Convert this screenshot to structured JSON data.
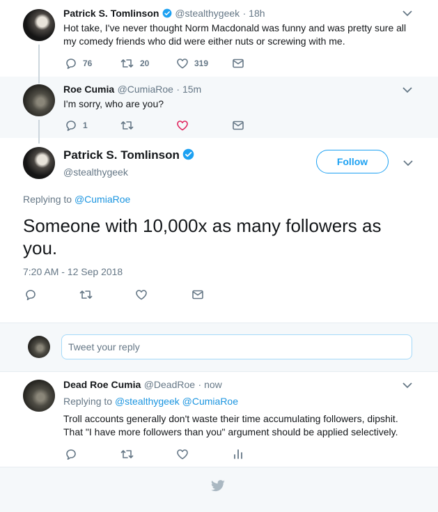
{
  "tweet1": {
    "author": "Patrick S. Tomlinson",
    "handle": "@stealthygeek",
    "time": "· 18h",
    "text": "Hot take, I've never thought Norm Macdonald was funny and was pretty sure all my comedy friends who did were either nuts or screwing with me.",
    "replies": "76",
    "retweets": "20",
    "likes": "319"
  },
  "tweet2": {
    "author": "Roe Cumia",
    "handle": "@CumiaRoe",
    "time": "· 15m",
    "text": "I'm sorry, who are you?",
    "replies": "1"
  },
  "main": {
    "author": "Patrick S. Tomlinson",
    "handle": "@stealthygeek",
    "follow_label": "Follow",
    "replying_prefix": "Replying to ",
    "replying_to": "@CumiaRoe",
    "text": "Someone with 10,000x as many followers as you.",
    "timestamp": "7:20 AM - 12 Sep 2018"
  },
  "compose": {
    "placeholder": "Tweet your reply"
  },
  "reply": {
    "author": "Dead Roe Cumia",
    "handle": "@DeadRoe",
    "time": "· now",
    "replying_prefix": "Replying to ",
    "replying_to_1": "@stealthygeek",
    "replying_to_2": "@CumiaRoe",
    "text": "Troll accounts generally don't waste their time accumulating followers, dipshit. That \"I have more followers than you\" argument should be applied selectively."
  },
  "colors": {
    "accent": "#1da1f2",
    "like_active": "#e0245e",
    "muted": "#657786"
  }
}
